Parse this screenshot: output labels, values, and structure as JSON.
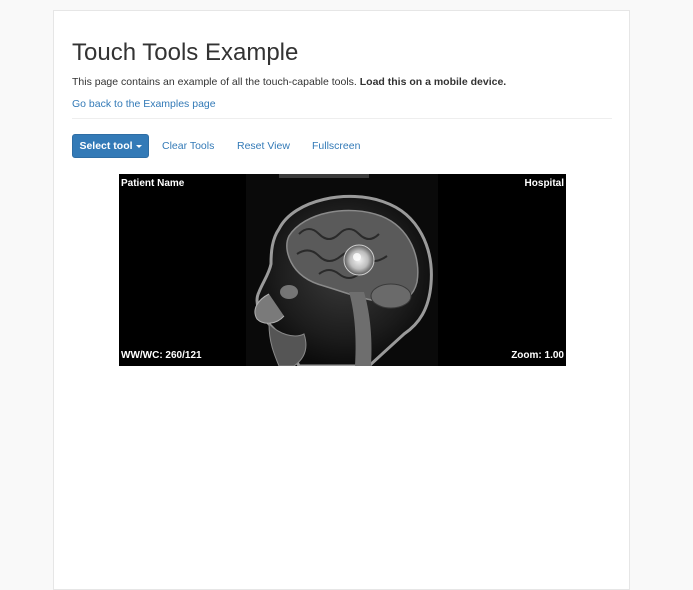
{
  "page": {
    "title": "Touch Tools Example",
    "description_text": "This page contains an example of all the touch-capable tools.",
    "description_bold": "Load this on a mobile device.",
    "back_link": "Go back to the Examples page"
  },
  "toolbar": {
    "select_tool_label": "Select tool",
    "clear_tools_label": "Clear Tools",
    "reset_view_label": "Reset View",
    "fullscreen_label": "Fullscreen"
  },
  "viewer": {
    "top_left": "Patient Name",
    "top_right": "Hospital",
    "bottom_left": "WW/WC: 260/121",
    "bottom_right": "Zoom: 1.00",
    "image_subject": "sagittal brain MRI"
  },
  "colors": {
    "link": "#337ab7",
    "primary_button": "#337ab7",
    "page_background": "#f9f9f9",
    "viewer_background": "#000000",
    "overlay_text": "#ffffff"
  },
  "icons": {
    "select_tool_caret": "caret-down-icon"
  }
}
